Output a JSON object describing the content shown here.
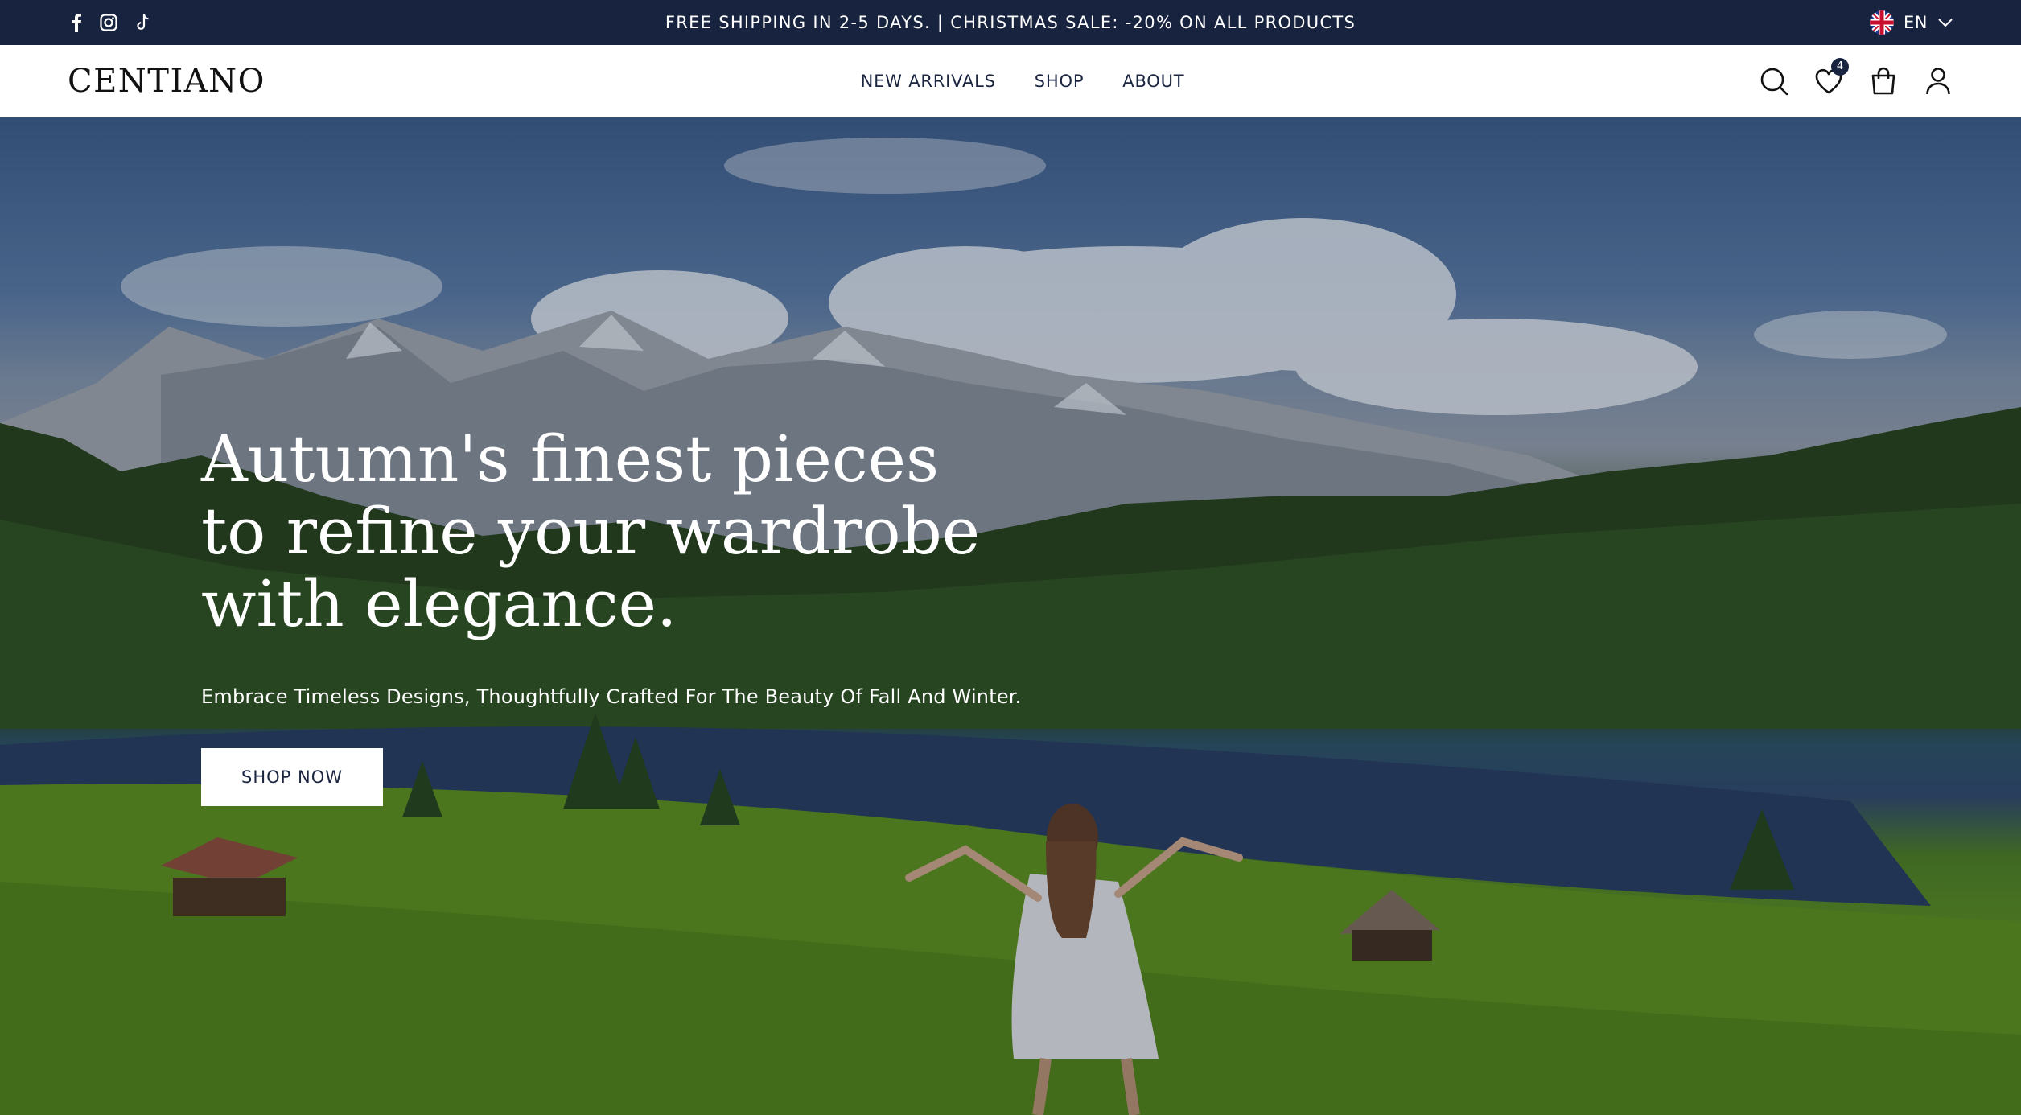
{
  "announcement": {
    "text": "FREE SHIPPING IN 2-5 DAYS. | CHRISTMAS SALE: -20% ON ALL PRODUCTS",
    "social_icons": [
      "facebook-icon",
      "instagram-icon",
      "tiktok-icon"
    ],
    "language": "EN",
    "language_flag": "uk-flag-icon"
  },
  "header": {
    "logo": "CENTIANO",
    "nav": [
      {
        "label": "NEW ARRIVALS"
      },
      {
        "label": "SHOP"
      },
      {
        "label": "ABOUT"
      }
    ],
    "icons": [
      "search-icon",
      "heart-icon",
      "bag-icon",
      "user-icon"
    ],
    "wishlist_count": "4"
  },
  "hero": {
    "title_lines": [
      "Autumn's finest pieces",
      "to refine your wardrobe",
      "with elegance."
    ],
    "subtitle": "Embrace Timeless Designs, Thoughtfully Crafted For The Beauty Of Fall And Winter.",
    "cta_label": "SHOP NOW"
  },
  "colors": {
    "navy": "#18233f",
    "white": "#ffffff"
  }
}
